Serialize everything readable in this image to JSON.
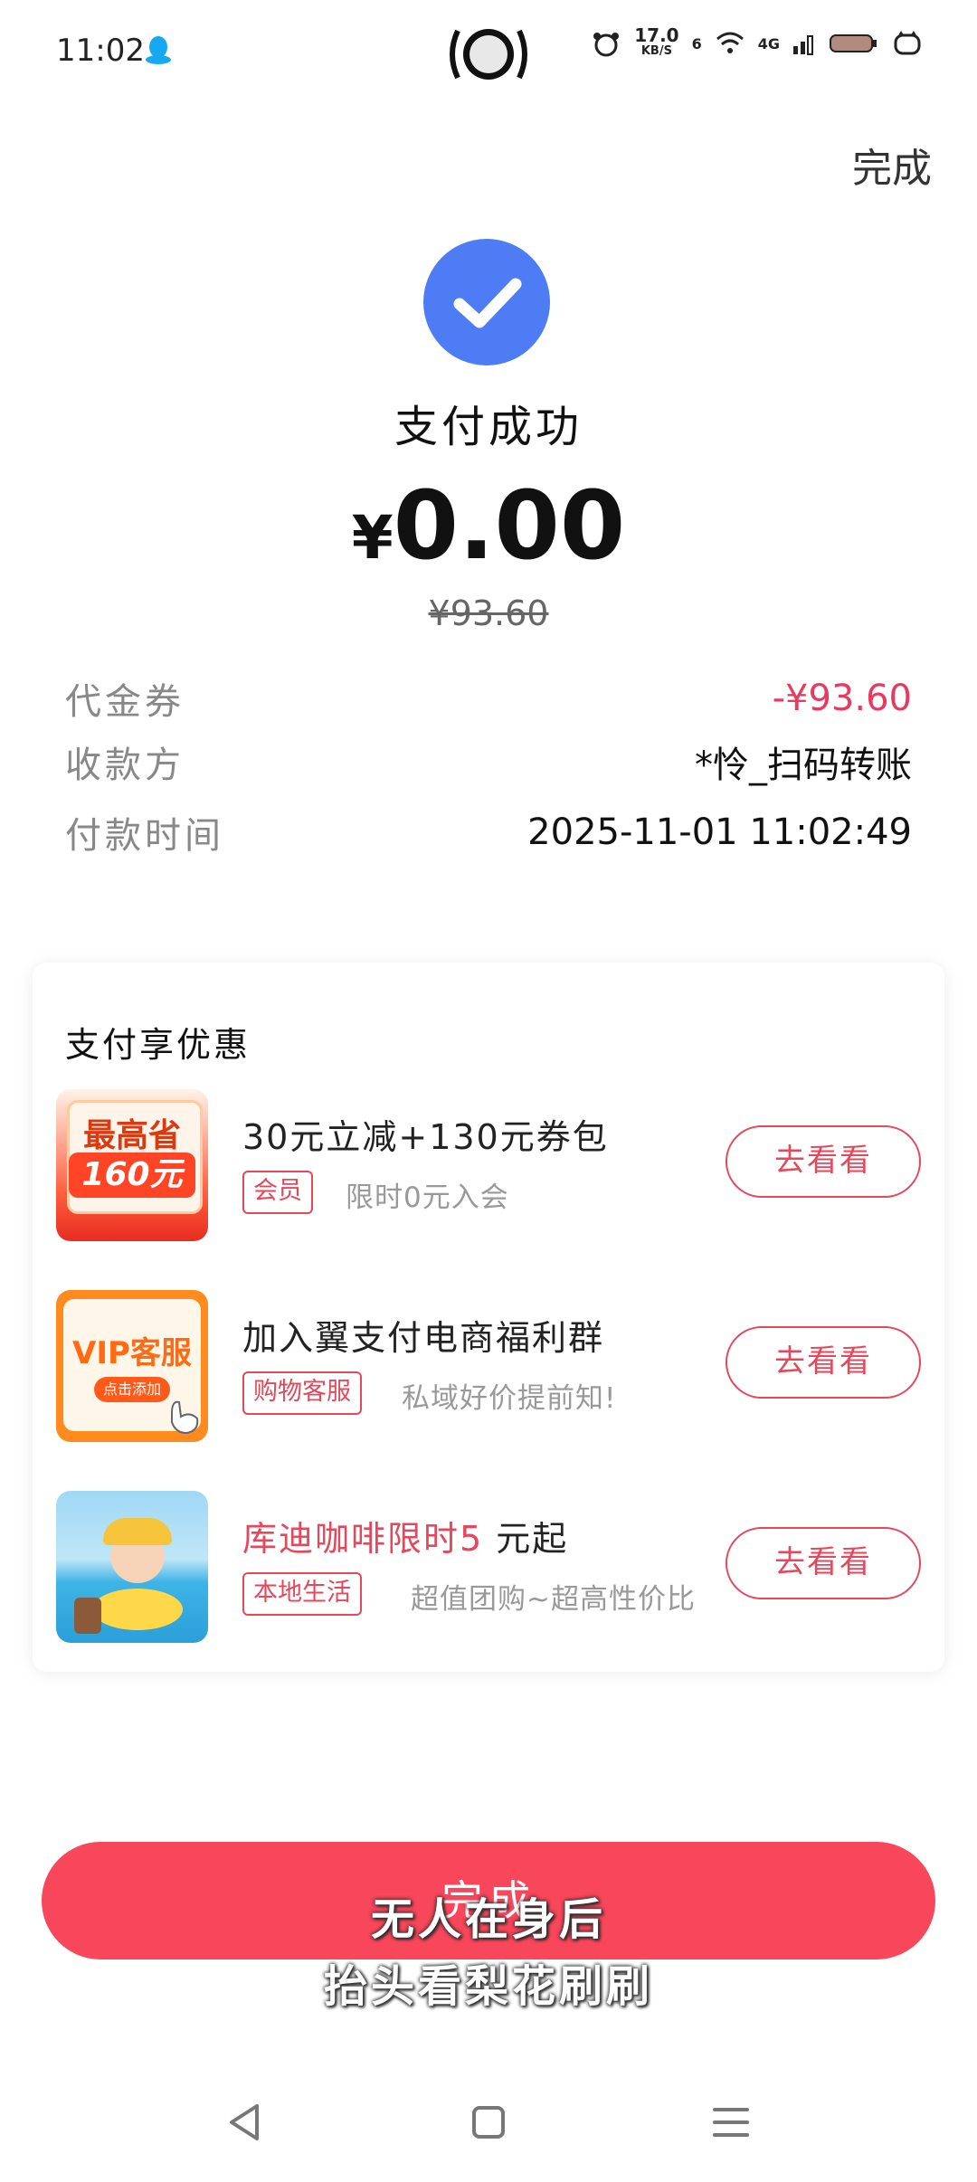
{
  "status_bar": {
    "time": "11:02",
    "network_speed": "17.0",
    "network_unit": "KB/S",
    "sim": "6",
    "signal_label": "4G"
  },
  "header": {
    "done_label": "完成"
  },
  "payment": {
    "title": "支付成功",
    "currency": "¥",
    "amount": "0.00",
    "original_amount": "¥93.60"
  },
  "details": [
    {
      "label": "代金券",
      "value": "-¥93.60",
      "highlight": true
    },
    {
      "label": "收款方",
      "value": "*怜_扫码转账",
      "highlight": false
    },
    {
      "label": "付款时间",
      "value": "2025-11-01 11:02:49",
      "highlight": false
    }
  ],
  "promotions": {
    "title": "支付享优惠",
    "items": [
      {
        "title": "30元立减+130元券包",
        "tag": "会员",
        "subtitle": "限时0元入会",
        "button": "去看看",
        "thumb_line1": "最高省",
        "thumb_line2": "160元"
      },
      {
        "title": "加入翼支付电商福利群",
        "tag": "购物客服",
        "subtitle": "私域好价提前知!",
        "button": "去看看",
        "thumb_line1": "VIP客服",
        "thumb_line2": "点击添加"
      },
      {
        "title_highlight": "库迪咖啡限时5",
        "title_rest": "元起",
        "tag": "本地生活",
        "subtitle": "超值团购~超高性价比",
        "button": "去看看"
      }
    ]
  },
  "bottom_button": {
    "label": "完成"
  },
  "overlay_subtitles": {
    "line1": "无人在身后",
    "line2": "抬头看梨花刷刷"
  },
  "colors": {
    "accent": "#f8465a",
    "check_blue": "#4d7cf4",
    "voucher_red": "#e83a5e"
  }
}
